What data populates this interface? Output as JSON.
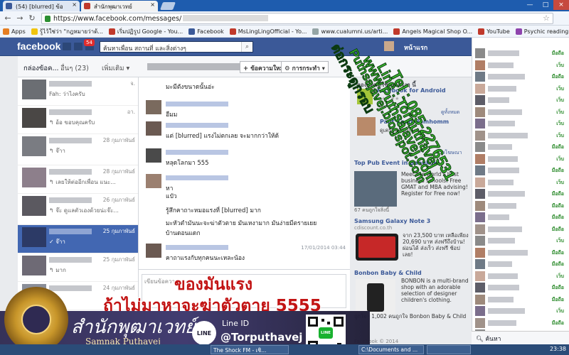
{
  "browser": {
    "tabs": [
      {
        "label": "(54) [blurred] ข้อ",
        "favicon_color": "#3b5998"
      },
      {
        "label": "สำนักพุฒาเวทย์",
        "favicon_color": "#c0392b"
      }
    ],
    "url_prefix": "https://www.facebook.com/messages/",
    "bookmarks": [
      {
        "label": "Apps",
        "color": "#e67e22"
      },
      {
        "label": "รู้ไว้ใช่ว่า \"กฎหมายว่าด้...",
        "color": "#f1c40f"
      },
      {
        "label": "เริ่มปฏิรูป Google - You...",
        "color": "#c0392b"
      },
      {
        "label": "Facebook",
        "color": "#3b5998"
      },
      {
        "label": "MsLingLingOfficial - Yo...",
        "color": "#c0392b"
      },
      {
        "label": "www.cualumni.us/arti...",
        "color": "#95a5a6"
      },
      {
        "label": "Angels Magical Shop O...",
        "color": "#c0392b"
      },
      {
        "label": "YouTube",
        "color": "#c0392b"
      },
      {
        "label": "Psychic reading | Horo...",
        "color": "#8e44ad"
      }
    ]
  },
  "facebook": {
    "logo": "facebook",
    "notification_count": "54",
    "search_placeholder": "ค้นหาเพื่อน สถานที่ และสิ่งต่างๆ",
    "home_label": "หน้าแรก",
    "inbox_title": "กล่องข้อค...",
    "other_label": "อื่นๆ (23)",
    "more_label": "เพิ่มเติม ▾",
    "new_message_label": "+ ข้อความใหม่",
    "actions_label": "⚙ การกระทำ ▾",
    "conversations": [
      {
        "date": "จ.",
        "preview": "Fah: ว่าไงครับ",
        "avatar": "#6b6e73"
      },
      {
        "date": "อา.",
        "preview": "↰ อ้อ ขอบคุณครับ",
        "avatar": "#4a4745"
      },
      {
        "date": "28 กุมภาพันธ์",
        "preview": "↰ จ๊าา",
        "avatar": "#7a7c82"
      },
      {
        "date": "28 กุมภาพันธ์",
        "preview": "↰ เลยให้ต่ออีกเพื่อน แนะ...",
        "avatar": "#8d7f8b"
      },
      {
        "date": "26 กุมภาพันธ์",
        "preview": "↰ จ๊ะ ดูแลตัวเองด้วยน่ะจ๊ะ...",
        "avatar": "#5b5960"
      },
      {
        "date": "25 กุมภาพันธ์",
        "preview": "✓ จ๊าา",
        "avatar": "#2c3a66",
        "selected": true
      },
      {
        "date": "25 กุมภาพันธ์",
        "preview": "↰ มาก",
        "avatar": "#6e6a75"
      },
      {
        "date": "24 กุมภาพันธ์",
        "preview": "",
        "avatar": "#8a8e99"
      }
    ],
    "thread": [
      {
        "text": "มะมีตังขนาดนั้นอ่ะ",
        "ts": "",
        "avatar": ""
      },
      {
        "text": "อืมม",
        "ts": "",
        "avatar": "#7a6a5e"
      },
      {
        "text": "แต่ [blurred] แรงไม่ตกเลย จะมากกว่าให้ด้",
        "ts": "",
        "avatar": "#6b5a52"
      },
      {
        "text": "หลุดโลกมา 555",
        "ts": "",
        "avatar": "#4a4a4a"
      },
      {
        "text": "หา",
        "ts": "",
        "avatar": "#9b8070"
      },
      {
        "text": "แป๋ว",
        "ts": "",
        "avatar": ""
      },
      {
        "text": "รู้สึกคาถาะหมอแรงที่ [blurred] มาก",
        "ts": "",
        "avatar": ""
      },
      {
        "text": "มะหัวตำมันนะจะฆ่าตัวตาย มันเหงามาก มันง่ายมีตรายเยย",
        "ts": "",
        "avatar": ""
      },
      {
        "text": "บ้านดอนแดก",
        "ts": "",
        "avatar": ""
      },
      {
        "text": "คาถาแรงกับทุกคนนะเหละน้อง",
        "ts": "17/01/2014 03:44",
        "avatar": "#6b5a52"
      }
    ],
    "compose_placeholder": "เขียนข้อความ...",
    "right_column": {
      "section_title": "ลองแอพที่ใช้งานจริงๆ นี้",
      "ads": [
        {
          "title": "Facebook for Android",
          "sub": "★★★★★",
          "body": ""
        },
        {
          "title": "",
          "sub": "ดูทั้งหมด",
          "body": ""
        },
        {
          "title": "Pant Kean Homhomm",
          "sub": "",
          "body": "ดูเครือปกปันกับน"
        },
        {
          "title": "",
          "sub": "สร้างโฆษณา",
          "body": ""
        },
        {
          "title": "Top Pub Event in Bangkok",
          "sub": "",
          "body": "Meet the world's best business schools! Free GMAT and MBA advising! Register for Free now!"
        },
        {
          "title": "",
          "sub": "",
          "body": "67 คนถูกใจสิ่งนี้"
        },
        {
          "title": "Samsung Galaxy Note 3",
          "sub": "cdiscount.co.th",
          "body": "จาก 23,500 บาท เหลือเพียง 20,690 บาท ส่งฟรีถึงบ้าน! ผ่อนได้ ส่งเร็ว ส่งฟรี ช้อปเลย!"
        },
        {
          "title": "Bonbon Baby & Child",
          "sub": "",
          "body": "BONBON is a multi-brand shop with an adorable selection of designer children's clothing."
        },
        {
          "title": "",
          "sub": "",
          "body": "ถูกใจ · 1,002 คนถูกใจ Bonbon Baby & Child"
        },
        {
          "title": "",
          "sub": "",
          "body": "Facebook © 2014"
        }
      ]
    },
    "chat_status_online": "มือถือ",
    "chat_status_web": "เว็บ",
    "chat_search_placeholder": "ค้นหา",
    "chat_rows": [
      "มือถือ",
      "เว็บ",
      "มือถือ",
      "เว็บ",
      "เว็บ",
      "เว็บ",
      "เว็บ",
      "เว็บ",
      "มือถือ",
      "เว็บ",
      "มือถือ",
      "เว็บ",
      "มือถือ",
      "มือถือ",
      "มือถือ",
      "มือถือ",
      "เว็บ",
      "มือถือ",
      "มือถือ",
      "เว็บ",
      "มือถือ",
      "มือถือ",
      "เว็บ",
      "มือถือ",
      "มือถือ"
    ]
  },
  "overlay": {
    "watermark_lines": [
      "ต่อกระดูกรอบ",
      "Puthsajavej.blogspot.com",
      "www.Puthsajavej.com",
      "Line : Torputhavej",
      "Tel : 085-2276531"
    ],
    "headline_1": "ของมันแรง",
    "headline_2": "ถ้าไม่มาหาจะฆ่าตัวตาย 5555",
    "brand_thai": "สำนักพุฒาเวทย์",
    "brand_english": "Samnak Puthavej",
    "line_logo_text": "LINE",
    "line_id_label": "Line ID",
    "line_id_value": "@Torputhavej"
  },
  "taskbar": {
    "items": [
      "The Shock FM - เชิ...",
      "C:\\Documents and ...",
      ""
    ],
    "clock": "23:38"
  }
}
